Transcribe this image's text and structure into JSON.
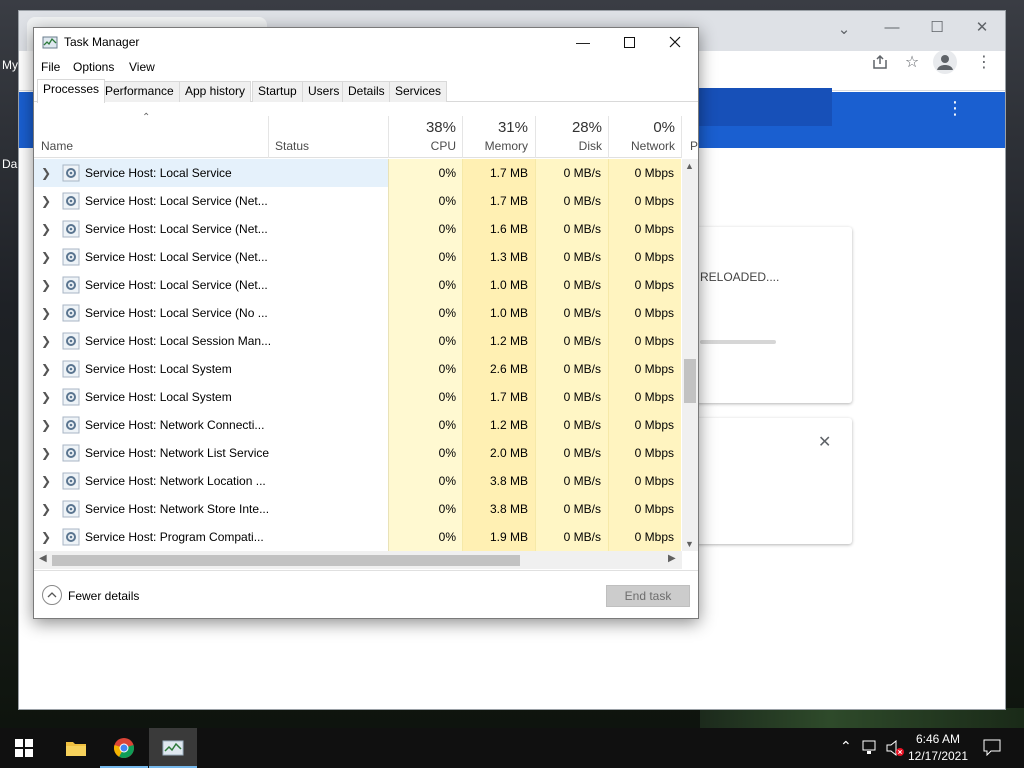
{
  "desktop": {
    "label_1": "My",
    "label_2": "Da"
  },
  "chrome": {
    "card_text": "RELOADED...."
  },
  "task_manager": {
    "title": "Task Manager",
    "menu": [
      "File",
      "Options",
      "View"
    ],
    "tabs": [
      "Processes",
      "Performance",
      "App history",
      "Startup",
      "Users",
      "Details",
      "Services"
    ],
    "active_tab": "Processes",
    "columns": {
      "name": "Name",
      "status": "Status",
      "cpu": {
        "label": "CPU",
        "percent": "38%"
      },
      "memory": {
        "label": "Memory",
        "percent": "31%"
      },
      "disk": {
        "label": "Disk",
        "percent": "28%"
      },
      "network": {
        "label": "Network",
        "percent": "0%"
      },
      "power_partial": "P"
    },
    "rows": [
      {
        "name": "Service Host: Local Service",
        "cpu": "0%",
        "memory": "1.7 MB",
        "disk": "0 MB/s",
        "network": "0 Mbps"
      },
      {
        "name": "Service Host: Local Service (Net...",
        "cpu": "0%",
        "memory": "1.7 MB",
        "disk": "0 MB/s",
        "network": "0 Mbps"
      },
      {
        "name": "Service Host: Local Service (Net...",
        "cpu": "0%",
        "memory": "1.6 MB",
        "disk": "0 MB/s",
        "network": "0 Mbps"
      },
      {
        "name": "Service Host: Local Service (Net...",
        "cpu": "0%",
        "memory": "1.3 MB",
        "disk": "0 MB/s",
        "network": "0 Mbps"
      },
      {
        "name": "Service Host: Local Service (Net...",
        "cpu": "0%",
        "memory": "1.0 MB",
        "disk": "0 MB/s",
        "network": "0 Mbps"
      },
      {
        "name": "Service Host: Local Service (No ...",
        "cpu": "0%",
        "memory": "1.0 MB",
        "disk": "0 MB/s",
        "network": "0 Mbps"
      },
      {
        "name": "Service Host: Local Session Man...",
        "cpu": "0%",
        "memory": "1.2 MB",
        "disk": "0 MB/s",
        "network": "0 Mbps"
      },
      {
        "name": "Service Host: Local System",
        "cpu": "0%",
        "memory": "2.6 MB",
        "disk": "0 MB/s",
        "network": "0 Mbps"
      },
      {
        "name": "Service Host: Local System",
        "cpu": "0%",
        "memory": "1.7 MB",
        "disk": "0 MB/s",
        "network": "0 Mbps"
      },
      {
        "name": "Service Host: Network Connecti...",
        "cpu": "0%",
        "memory": "1.2 MB",
        "disk": "0 MB/s",
        "network": "0 Mbps"
      },
      {
        "name": "Service Host: Network List Service",
        "cpu": "0%",
        "memory": "2.0 MB",
        "disk": "0 MB/s",
        "network": "0 Mbps"
      },
      {
        "name": "Service Host: Network Location ...",
        "cpu": "0%",
        "memory": "3.8 MB",
        "disk": "0 MB/s",
        "network": "0 Mbps"
      },
      {
        "name": "Service Host: Network Store Inte...",
        "cpu": "0%",
        "memory": "3.8 MB",
        "disk": "0 MB/s",
        "network": "0 Mbps"
      },
      {
        "name": "Service Host: Program Compati...",
        "cpu": "0%",
        "memory": "1.9 MB",
        "disk": "0 MB/s",
        "network": "0 Mbps"
      }
    ],
    "fewer_details": "Fewer details",
    "end_task": "End task"
  },
  "taskbar": {
    "time": "6:46 AM",
    "date": "12/17/2021"
  },
  "colors": {
    "accent_blue": "#1a5fd0",
    "heat_cpu": "#fff9d1",
    "heat_memory": "#fff0b3",
    "heat_disk": "#fff6c5",
    "heat_network": "#fff4c0"
  }
}
